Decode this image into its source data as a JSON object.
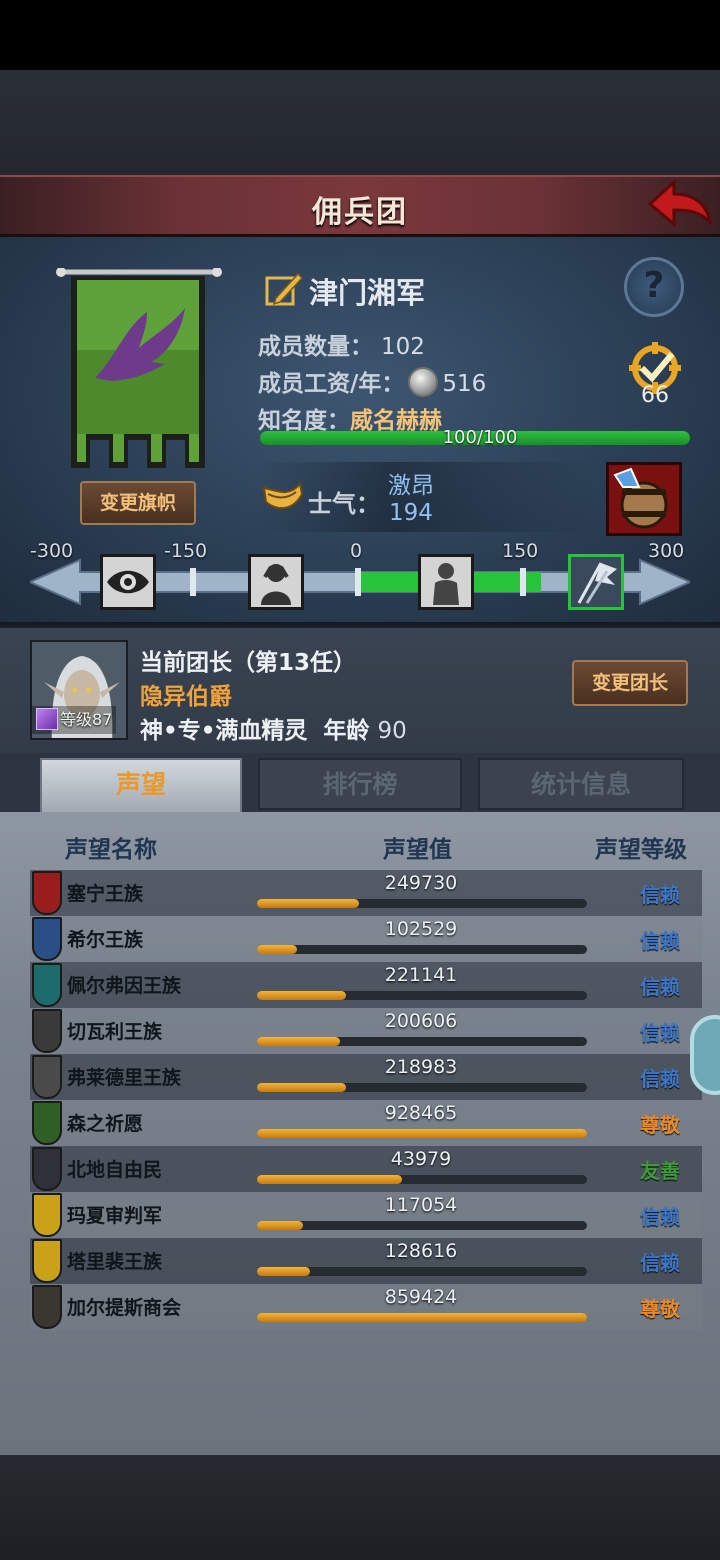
{
  "header": {
    "title": "佣兵团"
  },
  "legion": {
    "name": "津门湘军",
    "members_label": "成员数量：",
    "members_value": "102",
    "wage_label": "成员工资/年：",
    "wage_value": "516",
    "fame_label": "知名度：",
    "fame_title": "威名赫赫",
    "fame_bar_text": "100/100",
    "fame_fraction": 1.0,
    "badge_value": "66",
    "change_flag_label": "变更旗帜",
    "help_symbol": "?"
  },
  "morale": {
    "label": "士气：",
    "state": "激昂",
    "value": "194",
    "scale_ticks": [
      "-300",
      "-150",
      "0",
      "150",
      "300"
    ],
    "scale_min": -300,
    "scale_max": 300
  },
  "leader": {
    "heading": "当前团长（第13任）",
    "name": "隐异伯爵",
    "race": "神•专•满血精灵",
    "age_label": "年龄",
    "age_value": "90",
    "level_text": "等级87",
    "change_label": "变更团长"
  },
  "tabs": [
    {
      "label": "声望",
      "active": true
    },
    {
      "label": "排行榜",
      "active": false
    },
    {
      "label": "统计信息",
      "active": false
    }
  ],
  "reputation": {
    "col_name": "声望名称",
    "col_value": "声望值",
    "col_level": "声望等级",
    "rows": [
      {
        "name": "塞宁王族",
        "value": "249730",
        "fill": 0.31,
        "level": "信赖",
        "level_color": "#3e76c6",
        "emblem": "#9a1d1d"
      },
      {
        "name": "希尔王族",
        "value": "102529",
        "fill": 0.12,
        "level": "信赖",
        "level_color": "#3e76c6",
        "emblem": "#2a4f86"
      },
      {
        "name": "佩尔弗因王族",
        "value": "221141",
        "fill": 0.27,
        "level": "信赖",
        "level_color": "#3e76c6",
        "emblem": "#1d6b6a"
      },
      {
        "name": "切瓦利王族",
        "value": "200606",
        "fill": 0.25,
        "level": "信赖",
        "level_color": "#3e76c6",
        "emblem": "#3a3a3a"
      },
      {
        "name": "弗莱德里王族",
        "value": "218983",
        "fill": 0.27,
        "level": "信赖",
        "level_color": "#3e76c6",
        "emblem": "#4a4a4a"
      },
      {
        "name": "森之祈愿",
        "value": "928465",
        "fill": 1.0,
        "level": "尊敬",
        "level_color": "#e8892a",
        "emblem": "#2f5f24"
      },
      {
        "name": "北地自由民",
        "value": "43979",
        "fill": 0.44,
        "level": "友善",
        "level_color": "#3e9a3a",
        "emblem": "#2e3238"
      },
      {
        "name": "玛夏审判军",
        "value": "117054",
        "fill": 0.14,
        "level": "信赖",
        "level_color": "#3e76c6",
        "emblem": "#c9a21a"
      },
      {
        "name": "塔里裴王族",
        "value": "128616",
        "fill": 0.16,
        "level": "信赖",
        "level_color": "#3e76c6",
        "emblem": "#c9a21a"
      },
      {
        "name": "加尔提斯商会",
        "value": "859424",
        "fill": 1.0,
        "level": "尊敬",
        "level_color": "#e8892a",
        "emblem": "#3a3630"
      }
    ]
  }
}
